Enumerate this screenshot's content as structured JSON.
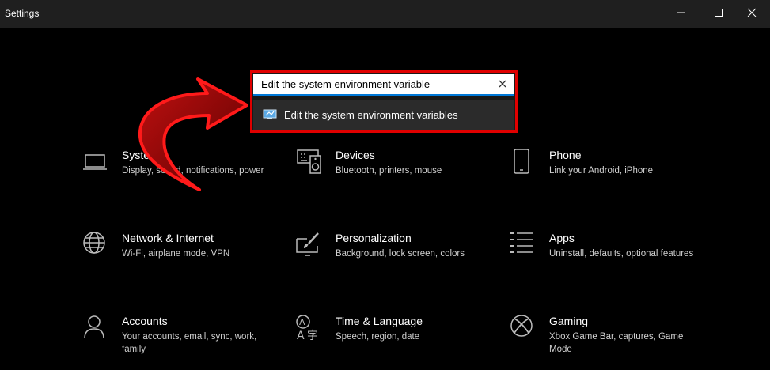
{
  "window": {
    "title": "Settings",
    "controls": [
      "minimize-icon",
      "maximize-icon",
      "close-icon"
    ]
  },
  "search": {
    "value": "Edit the system environment variable",
    "clear_icon": "close-icon",
    "suggestion": {
      "icon": "control-panel-icon",
      "label": "Edit the system environment variables"
    }
  },
  "tiles": [
    {
      "title": "System",
      "desc": "Display, sound, notifications, power",
      "icon": "laptop-icon"
    },
    {
      "title": "Devices",
      "desc": "Bluetooth, printers, mouse",
      "icon": "keyboard-speaker-icon"
    },
    {
      "title": "Phone",
      "desc": "Link your Android, iPhone",
      "icon": "phone-icon"
    },
    {
      "title": "Network & Internet",
      "desc": "Wi-Fi, airplane mode, VPN",
      "icon": "globe-icon"
    },
    {
      "title": "Personalization",
      "desc": "Background, lock screen, colors",
      "icon": "paint-brush-icon"
    },
    {
      "title": "Apps",
      "desc": "Uninstall, defaults, optional features",
      "icon": "apps-list-icon"
    },
    {
      "title": "Accounts",
      "desc": "Your accounts, email, sync, work, family",
      "icon": "person-icon"
    },
    {
      "title": "Time & Language",
      "desc": "Speech, region, date",
      "icon": "time-language-icon"
    },
    {
      "title": "Gaming",
      "desc": "Xbox Game Bar, captures, Game Mode",
      "icon": "xbox-icon"
    }
  ],
  "colors": {
    "highlight_border": "#e00000",
    "arrow": "#8b0000",
    "titlebar": "#1f1f1f",
    "background": "#000000"
  }
}
